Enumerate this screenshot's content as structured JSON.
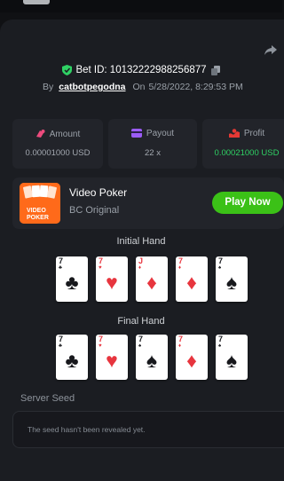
{
  "bet": {
    "bet_id_label": "Bet ID: 10132222988256877",
    "by_label": "By",
    "username": "catbotpegodna",
    "on_label": "On",
    "date": "5/28/2022, 8:29:53 PM"
  },
  "stats": [
    {
      "label": "Amount",
      "value": "0.00001000 USD",
      "icon": "coins-icon"
    },
    {
      "label": "Payout",
      "value": "22 x",
      "icon": "wallet-icon"
    },
    {
      "label": "Profit",
      "value": "0.00021000 USD",
      "icon": "profit-icon"
    }
  ],
  "game": {
    "name": "Video Poker",
    "provider": "BC Original",
    "play_label": "Play Now",
    "thumb_text": "VIDEO POKER"
  },
  "initial_hand": {
    "title": "Initial Hand",
    "cards": [
      {
        "rank": "7",
        "suit": "♣",
        "color": "black"
      },
      {
        "rank": "7",
        "suit": "♥",
        "color": "red"
      },
      {
        "rank": "J",
        "suit": "♦",
        "color": "red"
      },
      {
        "rank": "7",
        "suit": "♦",
        "color": "red"
      },
      {
        "rank": "7",
        "suit": "♠",
        "color": "black"
      }
    ]
  },
  "final_hand": {
    "title": "Final Hand",
    "cards": [
      {
        "rank": "7",
        "suit": "♣",
        "color": "black"
      },
      {
        "rank": "7",
        "suit": "♥",
        "color": "red"
      },
      {
        "rank": "7",
        "suit": "♠",
        "color": "black"
      },
      {
        "rank": "7",
        "suit": "♦",
        "color": "red"
      },
      {
        "rank": "7",
        "suit": "♠",
        "color": "black"
      }
    ]
  },
  "seed": {
    "title": "Server Seed",
    "message": "The seed hasn't been revealed yet."
  },
  "colors": {
    "accent_green": "#3bc117",
    "profit_green": "#2fd164",
    "card_red": "#e7353e",
    "amount_icon": "#ec4b7d",
    "payout_icon": "#9b5cf6",
    "profit_icon": "#e53935"
  }
}
